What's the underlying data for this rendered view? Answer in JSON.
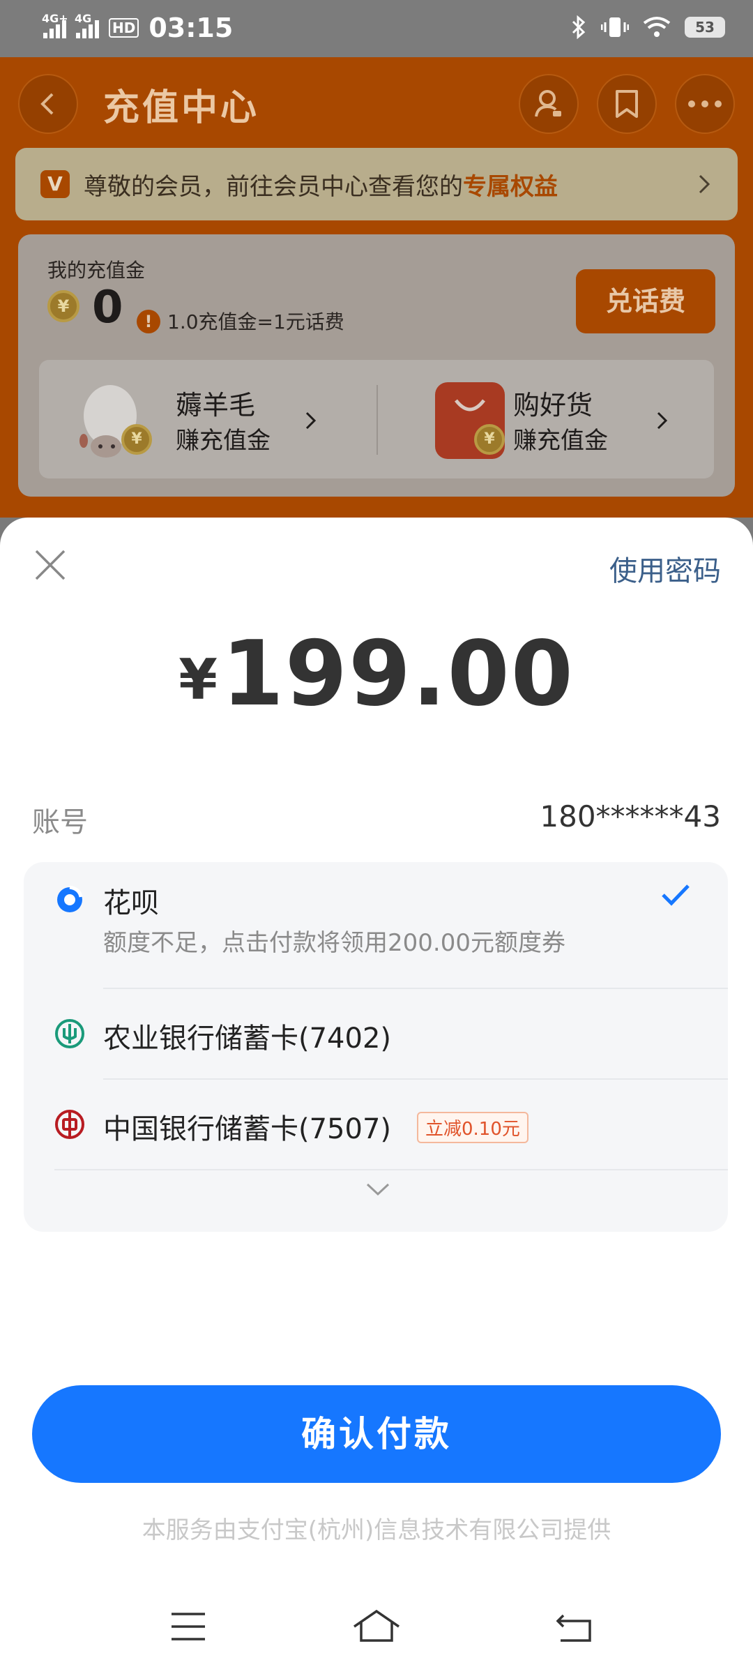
{
  "status_bar": {
    "net1": "4G+",
    "net2": "4G",
    "hd": "HD",
    "time": "03:15",
    "battery": "53"
  },
  "header": {
    "title": "充值中心"
  },
  "member_banner": {
    "badge": "V",
    "text": "尊敬的会员，前往会员中心查看您的",
    "link": "专属权益"
  },
  "balance_card": {
    "label": "我的充值金",
    "coin": "¥",
    "balance": "0",
    "warn": "!",
    "rate": "1.0充值金=1元话费",
    "exchange_button": "兑话费",
    "items": [
      {
        "title": "薅羊毛",
        "desc": "赚充值金"
      },
      {
        "title": "购好货",
        "desc": "赚充值金"
      }
    ]
  },
  "sheet": {
    "use_password": "使用密码",
    "currency": "¥",
    "amount": "199.00",
    "account_label": "账号",
    "account_value": "180******43",
    "methods": [
      {
        "name": "花呗",
        "note": "额度不足，点击付款将领用200.00元额度券",
        "selected": true
      },
      {
        "name": "农业银行储蓄卡(7402)"
      },
      {
        "name": "中国银行储蓄卡(7507)",
        "promo": "立减0.10元"
      }
    ],
    "confirm": "确认付款",
    "provider": "本服务由支付宝(杭州)信息技术有限公司提供"
  },
  "colors": {
    "accent_orange": "#ff6a00",
    "pay_blue": "#1677ff",
    "abc_green": "#1a9a7a",
    "boc_red": "#b81c22"
  }
}
